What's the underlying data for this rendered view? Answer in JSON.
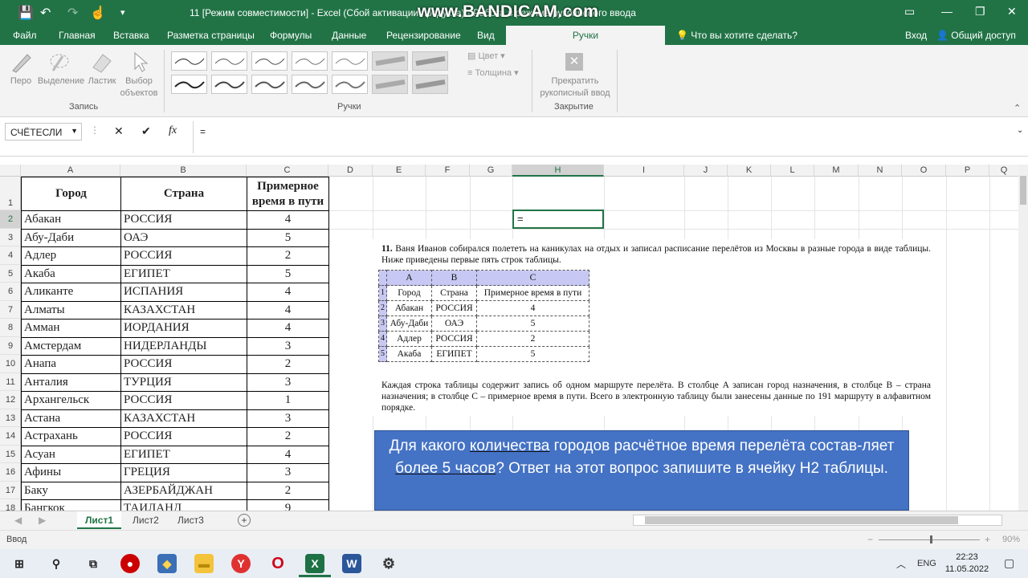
{
  "titlebar": {
    "doc_title": "11  [Режим совместимости] - Excel (Сбой активации продукта) - Работа в режиме рукописного ввода",
    "watermark": "www.BANDICAM.com"
  },
  "tabs": [
    "Файл",
    "Главная",
    "Вставка",
    "Разметка страницы",
    "Формулы",
    "Данные",
    "Рецензирование",
    "Вид",
    "Ручки"
  ],
  "tellme": "Что вы хотите сделать?",
  "signin": "Вход",
  "share": "Общий доступ",
  "ribbon": {
    "tools": [
      {
        "label": "Перо"
      },
      {
        "label": "Выделение"
      },
      {
        "label": "Ластик"
      },
      {
        "label": "Выбор объектов"
      }
    ],
    "group_record": "Запись",
    "group_pens": "Ручки",
    "color_label": "Цвет",
    "thickness_label": "Толщина",
    "stop_label": "Прекратить рукописный ввод",
    "group_close": "Закрытие"
  },
  "formula_bar": {
    "name_box": "СЧЁТЕСЛИ",
    "formula": "="
  },
  "columns": [
    "A",
    "B",
    "C",
    "D",
    "E",
    "F",
    "G",
    "H",
    "I",
    "J",
    "K",
    "L",
    "M",
    "N",
    "O",
    "P",
    "Q"
  ],
  "rows": [
    "1",
    "2",
    "3",
    "4",
    "5",
    "6",
    "7",
    "8",
    "9",
    "10",
    "11",
    "12",
    "13",
    "14",
    "15",
    "16",
    "17",
    "18"
  ],
  "table": {
    "headers": [
      "Город",
      "Страна",
      "Примерное время в пути"
    ],
    "rows": [
      [
        "Абакан",
        "РОССИЯ",
        "4"
      ],
      [
        "Абу-Даби",
        "ОАЭ",
        "5"
      ],
      [
        "Адлер",
        "РОССИЯ",
        "2"
      ],
      [
        "Акаба",
        "ЕГИПЕТ",
        "5"
      ],
      [
        "Аликанте",
        "ИСПАНИЯ",
        "4"
      ],
      [
        "Алматы",
        "КАЗАХСТАН",
        "4"
      ],
      [
        "Амман",
        "ИОРДАНИЯ",
        "4"
      ],
      [
        "Амстердам",
        "НИДЕРЛАНДЫ",
        "3"
      ],
      [
        "Анапа",
        "РОССИЯ",
        "2"
      ],
      [
        "Анталия",
        "ТУРЦИЯ",
        "3"
      ],
      [
        "Архангельск",
        "РОССИЯ",
        "1"
      ],
      [
        "Астана",
        "КАЗАХСТАН",
        "3"
      ],
      [
        "Астрахань",
        "РОССИЯ",
        "2"
      ],
      [
        "Асуан",
        "ЕГИПЕТ",
        "4"
      ],
      [
        "Афины",
        "ГРЕЦИЯ",
        "3"
      ],
      [
        "Баку",
        "АЗЕРБАЙДЖАН",
        "2"
      ],
      [
        "Бангкок",
        "ТАИЛАНД",
        "9"
      ]
    ]
  },
  "active_cell": "=",
  "task": {
    "number": "11.",
    "intro": "Ваня Иванов собирался полететь на каникулах на отдых и записал расписание перелётов из Москвы в разные города в виде таблицы. Ниже приведены первые пять строк таблицы.",
    "mini_cols": [
      "A",
      "B",
      "C"
    ],
    "mini_rows": [
      [
        "1",
        "Город",
        "Страна",
        "Примерное время в пути"
      ],
      [
        "2",
        "Абакан",
        "РОССИЯ",
        "4"
      ],
      [
        "3",
        "Абу-Даби",
        "ОАЭ",
        "5"
      ],
      [
        "4",
        "Адлер",
        "РОССИЯ",
        "2"
      ],
      [
        "5",
        "Акаба",
        "ЕГИПЕТ",
        "5"
      ]
    ],
    "description": "Каждая строка таблицы содержит запись об одном маршруте перелёта. В столбце A записан город назначения, в столбце B – страна назначения; в столбце C – примерное время в пути. Всего в электронную таблицу были занесены данные по 191 маршруту в алфавитном порядке.",
    "q1": "Для какого ",
    "q_u1": "количества",
    "q2": " городов расчётное время перелёта состав-ляет ",
    "q_u2": "более 5 часов",
    "q3": "? Ответ на этот вопрос запишите в ячейку H2 таблицы."
  },
  "sheets": [
    "Лист1",
    "Лист2",
    "Лист3"
  ],
  "status": {
    "mode": "Ввод",
    "zoom": "90%"
  },
  "taskbar": {
    "lang": "ENG",
    "time": "22:23",
    "date": "11.05.2022"
  },
  "colors": {
    "accent": "#217346",
    "question_bg": "#4472c4"
  }
}
